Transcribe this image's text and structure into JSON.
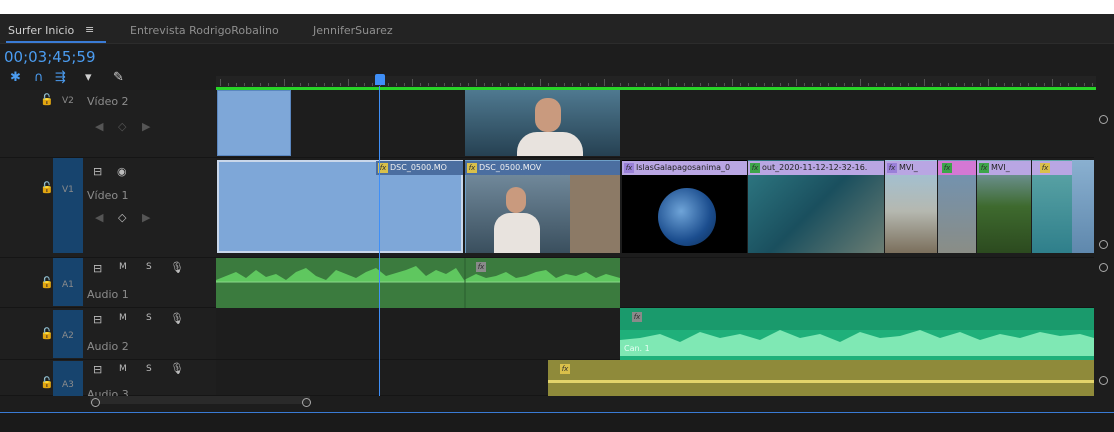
{
  "tabs": [
    {
      "label": "Surfer Inicio"
    },
    {
      "label": "Entrevista RodrigoRobalino"
    },
    {
      "label": "JenniferSuarez"
    }
  ],
  "menu_icon": "≡",
  "timecode": "00;03;45;59",
  "tracks": {
    "v2": {
      "id": "V2",
      "name": "Vídeo 2"
    },
    "v1": {
      "id": "V1",
      "name": "Vídeo 1"
    },
    "a1": {
      "id": "A1",
      "name": "Audio 1",
      "m": "M",
      "s": "S"
    },
    "a2": {
      "id": "A2",
      "name": "Audio 2",
      "m": "M",
      "s": "S"
    },
    "a3": {
      "id": "A3",
      "name": "Audio 3",
      "m": "M",
      "s": "S"
    }
  },
  "clips": {
    "v1_a": "DSC_0500.MO",
    "v1_b": "DSC_0500.MOV",
    "v1_c": "IslasGalapagosanima_0",
    "v1_d": "out_2020-11-12-12-32-16.",
    "v1_e": "MVI_",
    "v1_f": "MVI_",
    "a2_label": "Can. 1"
  },
  "colors": {
    "accent": "#3f8ff7",
    "timeline_green": "#28d428",
    "audio1": "#3b7b3e",
    "audio2": "#1fb07a",
    "audio3": "#8f8a3a"
  }
}
